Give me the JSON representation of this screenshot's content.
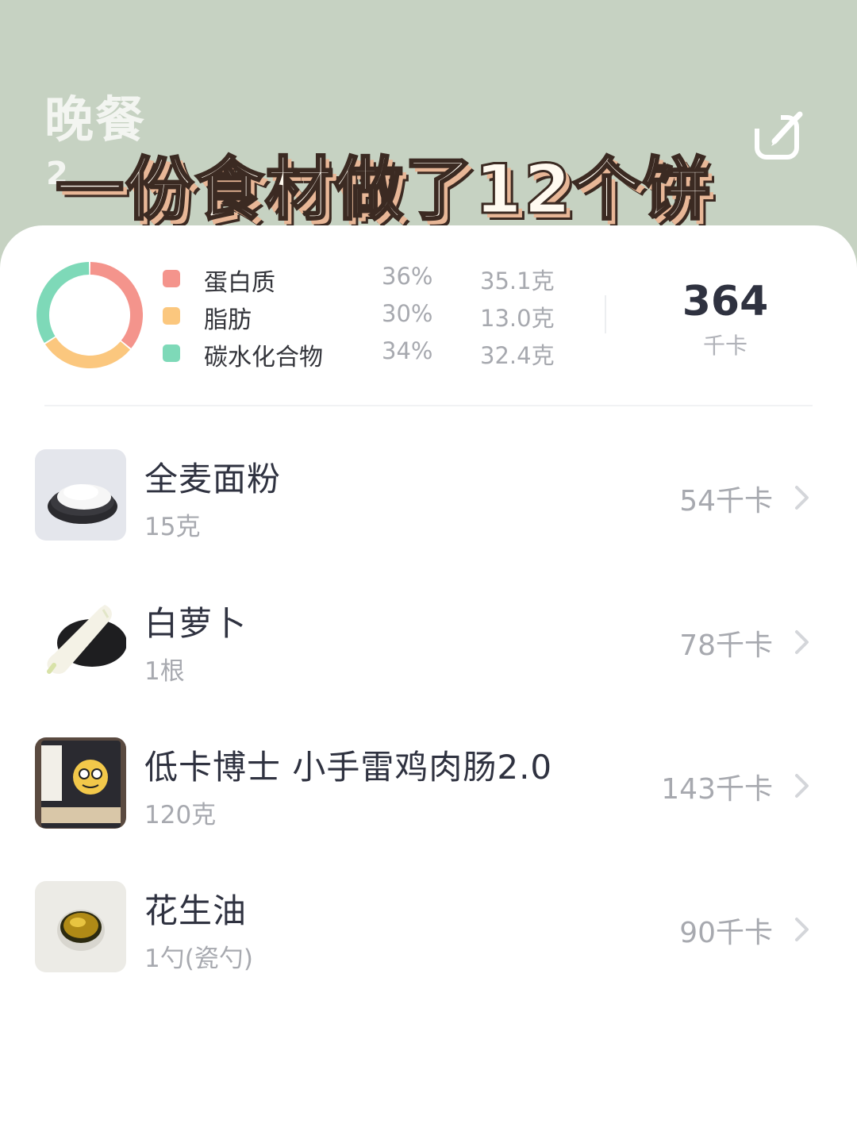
{
  "header": {
    "title": "晚餐",
    "date_fragment": "2",
    "overlay_caption": "一份食材做了12个饼",
    "edit_icon": "edit-icon"
  },
  "summary": {
    "macros": [
      {
        "name": "蛋白质",
        "percent": "36%",
        "amount": "35.1克",
        "color": "#f4948c"
      },
      {
        "name": "脂肪",
        "percent": "30%",
        "amount": "13.0克",
        "color": "#fbc77e"
      },
      {
        "name": "碳水化合物",
        "percent": "34%",
        "amount": "32.4克",
        "color": "#7ed9b8"
      }
    ],
    "total_kcal": "364",
    "total_unit": "千卡"
  },
  "foods": [
    {
      "name": "全麦面粉",
      "quantity": "15克",
      "kcal": "54千卡",
      "icon": "flour-image"
    },
    {
      "name": "白萝卜",
      "quantity": "1根",
      "kcal": "78千卡",
      "icon": "radish-image"
    },
    {
      "name": "低卡博士 小手雷鸡肉肠2.0",
      "quantity": "120克",
      "kcal": "143千卡",
      "icon": "sausage-package-image"
    },
    {
      "name": "花生油",
      "quantity": "1勺(瓷勺)",
      "kcal": "90千卡",
      "icon": "peanut-oil-image"
    }
  ],
  "colors": {
    "header_bg": "#c6d2c2",
    "protein": "#f4948c",
    "fat": "#fbc77e",
    "carbs": "#7ed9b8"
  }
}
